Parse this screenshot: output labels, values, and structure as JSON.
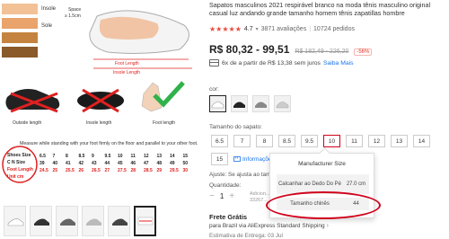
{
  "gallery": {
    "image_labels": {
      "insole_text": "Insole",
      "sole_text": "Sole",
      "space_text": "Space",
      "space_value": "≥ 1.5cm",
      "foot_length": "Foot Length",
      "insole_length": "Insole Length",
      "outsole_length": "Outside length",
      "insole_caption": "Insole length",
      "foot_caption": "Foot length",
      "instruction": "Measure while standing with your foot firmly on the floor and parallel to your other foot.",
      "table_headers": [
        "Shoes Size",
        "C N Size",
        "Foot Length",
        "Unit cm"
      ],
      "table_row1": [
        "6.5",
        "7",
        "8",
        "8.5",
        "9",
        "9.5",
        "10",
        "11",
        "12",
        "13",
        "14",
        "15"
      ],
      "table_row2": [
        "39",
        "40",
        "41",
        "42",
        "43",
        "44",
        "45",
        "46",
        "47",
        "48",
        "49",
        "50"
      ],
      "table_row3": [
        "24.5",
        "25",
        "25.5",
        "26",
        "26.5",
        "27",
        "27.5",
        "28",
        "28.5",
        "29",
        "29.5",
        "30"
      ]
    },
    "thumbs": [
      "thumb-1",
      "thumb-2",
      "thumb-3",
      "thumb-4",
      "thumb-5",
      "thumb-6"
    ]
  },
  "product": {
    "title": "Sapatos masculinos 2021 respirável branco na moda tênis masculino original casual luz andando grande tamanho homem tênis zapatillas hombre",
    "stars": "★★★★★",
    "rating": "4.7",
    "reviews": "3871 avaliações",
    "orders": "10724 pedidos",
    "price": "R$ 80,32 - 99,51",
    "old_price": "R$ 182,49 - 226,20",
    "discount": "-56%",
    "installments_text": "6x de a partir de R$ 13,38 sem juros",
    "installments_link": "Saiba Mais",
    "color_label": "cor:",
    "size_label": "Tamanho do sapato:",
    "sizes_row1": [
      "6.5",
      "7",
      "8",
      "8.5",
      "9.5",
      "10",
      "11",
      "12",
      "13",
      "14"
    ],
    "sizes_row2": [
      "15"
    ],
    "selected_size": "10",
    "size_info_link": "Informações",
    "adjust_note": "Ajuste: Se ajusta ao tamanho",
    "qty_label": "Quantidade:",
    "qty_minus": "−",
    "qty_value": "1",
    "qty_plus": "+",
    "qty_side_1": "Adicion...",
    "qty_side_2": "33267...",
    "shipping_title": "Frete Grátis",
    "shipping_line": "para Brazil via AliExpress Standard Shipping",
    "shipping_est": "Estimativa de Entrega: 03 Jul"
  },
  "popover": {
    "header": "Manufacturer Size",
    "row1_key": "Calcanhar ao Dedo Do Pé",
    "row1_val": "27.0 cm",
    "row2_key": "Tamanho chinês",
    "row2_val": "44"
  },
  "colors": {
    "accent_red": "#d0021b",
    "link_blue": "#1a73e8",
    "star_red": "#e84b3c"
  }
}
